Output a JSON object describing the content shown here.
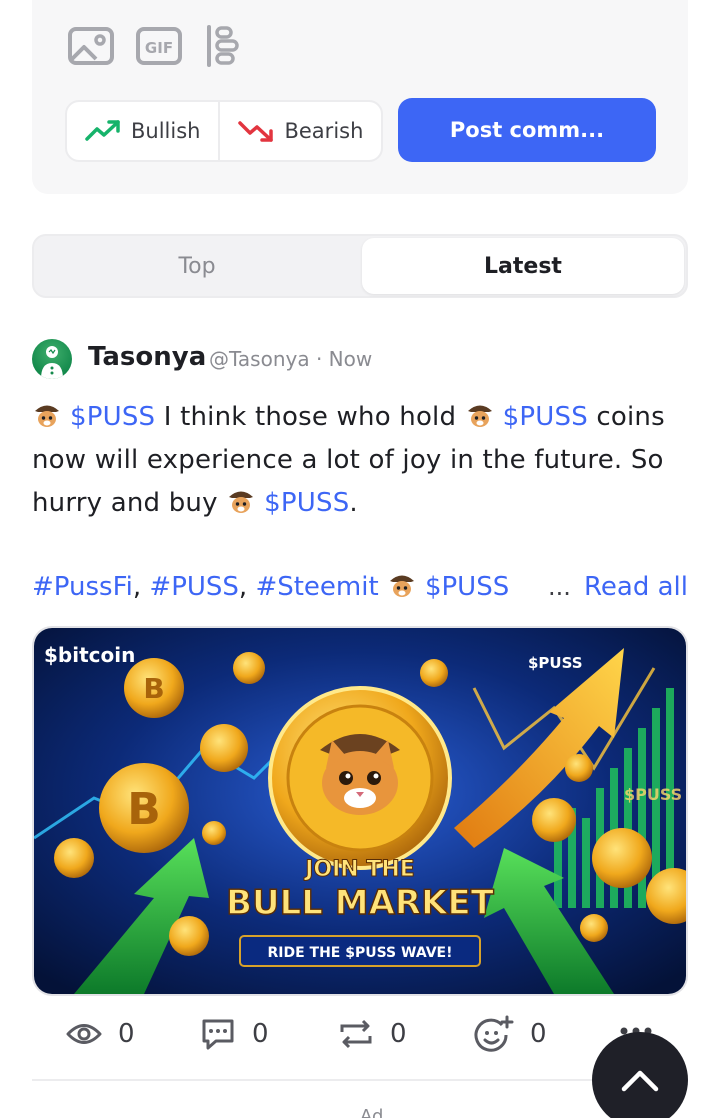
{
  "composer": {
    "tools": [
      {
        "icon": "image-icon"
      },
      {
        "icon": "gif-icon",
        "label": "GIF"
      },
      {
        "icon": "poll-icon"
      }
    ],
    "sentiment": {
      "bullish_label": "Bullish",
      "bearish_label": "Bearish",
      "bullish_color": "#16b36b",
      "bearish_color": "#e2353f"
    },
    "post_button_label": "Post comm..."
  },
  "tabs": {
    "top_label": "Top",
    "latest_label": "Latest",
    "active": "Latest"
  },
  "post": {
    "author": "Tasonya",
    "handle": "@Tasonya",
    "dot": "·",
    "time": "Now",
    "text": {
      "cashtag": "$PUSS",
      "seg1": "I think those who hold",
      "seg2": "coins now will experience a lot of joy in the future. So hurry and buy",
      "seg3": "."
    },
    "tags": {
      "tag1": "#PussFi",
      "sep": ",",
      "tag2": "#PUSS",
      "tag3": "#Steemit",
      "ellipsis": "...",
      "read_all": "Read all"
    },
    "image": {
      "main_text_1": "JOIN THE",
      "main_text_2": "BULL MARKET",
      "sub_text": "RIDE THE $PUSS WAVE!",
      "bitcoin_label": "$bitcoin",
      "puss_label_1": "$PUSS",
      "puss_label_2": "$PUSS"
    },
    "metrics": {
      "views": "0",
      "comments": "0",
      "reposts": "0",
      "reactions": "0"
    }
  },
  "footer": {
    "ad_label": "Ad"
  },
  "colors": {
    "accent": "#3d66f5",
    "text": "#1e1f24",
    "muted": "#8a8b91"
  }
}
